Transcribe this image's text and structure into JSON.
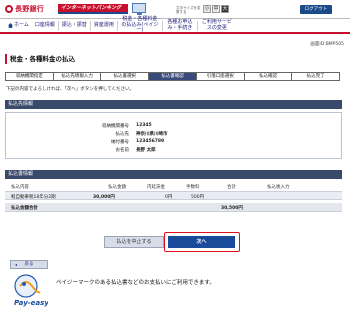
{
  "header": {
    "bank_name": "長野銀行",
    "service_name": "インターネットバンキング",
    "font_size_label": "文字サイズを変更する",
    "font_sizes": [
      "小",
      "中",
      "大"
    ],
    "logout_label": "ログアウト"
  },
  "nav": {
    "items": [
      {
        "label": "ホーム"
      },
      {
        "label": "口座情報"
      },
      {
        "label": "振込・振替"
      },
      {
        "label": "資産運用"
      },
      {
        "label": "税金・各種料金の払込み(ペイジー)"
      },
      {
        "label": "各種お申込み・手続き"
      },
      {
        "label": "ご利用サービスの変更"
      }
    ]
  },
  "page": {
    "screen_id": "画面ID:BMP505",
    "title": "税金・各種料金の払込",
    "instruction": "下記の内容でよろしければ、「次へ」ボタンを押してください。"
  },
  "steps": [
    {
      "label": "収納機関指定",
      "active": false
    },
    {
      "label": "払込先情報入力",
      "active": false
    },
    {
      "label": "払込書選択",
      "active": false
    },
    {
      "label": "払込書確認",
      "active": true
    },
    {
      "label": "引落口座選択",
      "active": false
    },
    {
      "label": "払込確認",
      "active": false
    },
    {
      "label": "払込完了",
      "active": false
    }
  ],
  "payee_section": {
    "title": "払込先情報",
    "rows": [
      {
        "label": "収納機関番号",
        "value": "12345"
      },
      {
        "label": "払込先",
        "value": "神奈川県川崎市"
      },
      {
        "label": "納付番号",
        "value": "123456789"
      },
      {
        "label": "お名前",
        "value": "長野 太郎"
      }
    ]
  },
  "bill_section": {
    "title": "払込書情報",
    "columns": [
      "払込内容",
      "払込金額",
      "内延滞金",
      "手数料",
      "合計",
      "払込後入力"
    ],
    "rows": [
      {
        "content": "軽自動車税18年分2期",
        "amount": "30,000円",
        "late_fee": "0円",
        "fee": "500円",
        "total": "",
        "after": ""
      }
    ],
    "total_label": "払込金額合計",
    "total_value": "30,500円"
  },
  "buttons": {
    "stop": "払込を中止する",
    "next": "次へ",
    "back": "戻る"
  },
  "payeasy": {
    "logo_text": "Pay-easy",
    "description": "ペイジーマークのある払込書などのお支払いにご利用できます。"
  }
}
